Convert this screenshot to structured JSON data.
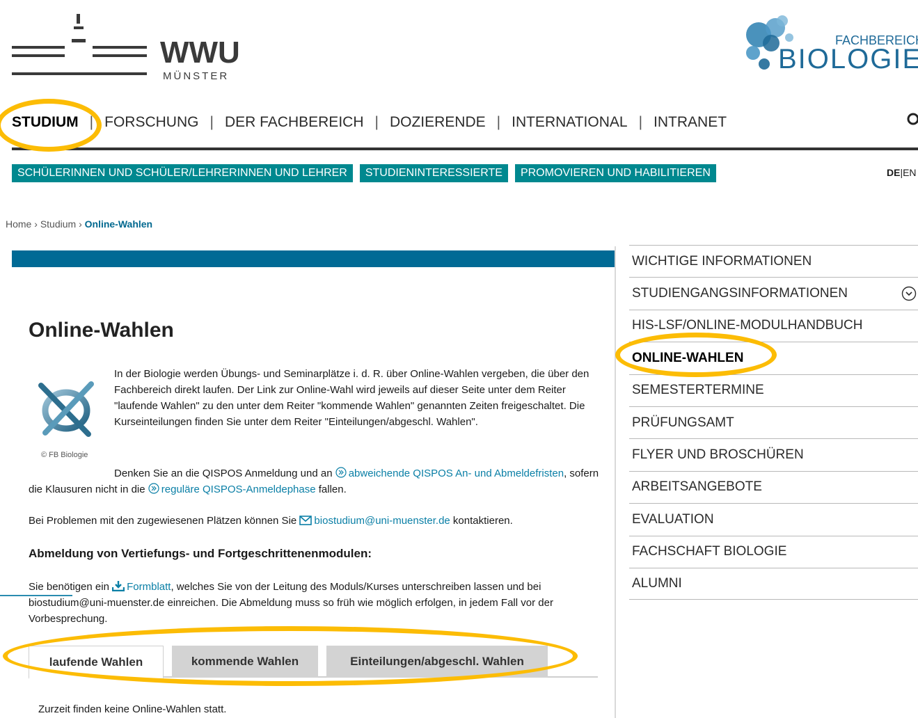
{
  "header": {
    "wwu_name": "WWU",
    "wwu_city": "MÜNSTER",
    "bio_prefix": "FACHBEREICH",
    "bio_name": "BIOLOGIE"
  },
  "main_nav": [
    "STUDIUM",
    "FORSCHUNG",
    "DER FACHBEREICH",
    "DOZIERENDE",
    "INTERNATIONAL",
    "INTRANET"
  ],
  "sub_nav": [
    "SCHÜLERINNEN UND SCHÜLER/LEHRERINNEN UND LEHRER",
    "STUDIENINTERESSIERTE",
    "PROMOVIEREN UND HABILITIEREN"
  ],
  "lang": {
    "active": "DE",
    "other": "EN"
  },
  "breadcrumb": {
    "home": "Home",
    "studium": "Studium",
    "current": "Online-Wahlen",
    "sep": "›"
  },
  "content": {
    "title": "Online-Wahlen",
    "image_caption": "© FB Biologie",
    "intro": "In der Biologie werden Übungs- und Seminarplätze i. d. R. über Online-Wahlen vergeben, die über den Fachbereich direkt laufen. Der Link zur Online-Wahl wird jeweils auf dieser Seite unter dem Reiter \"laufende Wahlen\" zu den unter dem Reiter \"kommende Wahlen\" genannten Zeiten freigeschaltet. Die Kurseinteilungen finden Sie unter dem Reiter \"Einteilungen/abgeschl. Wahlen\".",
    "qispos_pre": "Denken Sie an die QISPOS Anmeldung und an ",
    "qispos_link1": "abweichende QISPOS An- und Abmeldefristen",
    "qispos_mid": ", sofern die Klausuren nicht in die ",
    "qispos_link2": "reguläre QISPOS-Anmeldephase",
    "qispos_post": " fallen.",
    "problems_pre": "Bei Problemen mit den zugewiesenen Plätzen können Sie ",
    "problems_email": "biostudium@uni-muenster.de",
    "problems_post": " kontaktieren.",
    "abm_heading": "Abmeldung von Vertiefungs- und Fortgeschrittenenmodulen:",
    "abm_pre": "Sie benötigen ein ",
    "abm_link": "Formblatt",
    "abm_post": ", welches Sie von der Leitung des Moduls/Kurses unterschreiben lassen und bei biostudium@uni-muenster.de einreichen. Die Abmeldung muss so früh wie möglich erfolgen, in jedem Fall vor der Vorbesprechung.",
    "tabs": [
      "laufende Wahlen",
      "kommende Wahlen",
      "Einteilungen/abgeschl. Wahlen"
    ],
    "no_elections": "Zurzeit finden keine Online-Wahlen statt."
  },
  "sidebar": [
    "WICHTIGE INFORMATIONEN",
    "STUDIENGANGSINFORMATIONEN",
    "HIS-LSF/ONLINE-MODULHANDBUCH",
    "ONLINE-WAHLEN",
    "SEMESTERTERMINE",
    "PRÜFUNGSAMT",
    "FLYER UND BROSCHÜREN",
    "ARBEITSANGEBOTE",
    "EVALUATION",
    "FACHSCHAFT BIOLOGIE",
    "ALUMNI"
  ],
  "colors": {
    "accent_teal": "#00888f",
    "accent_blue": "#006a95",
    "highlight": "#fcbc05",
    "link": "#0a7fa6"
  }
}
